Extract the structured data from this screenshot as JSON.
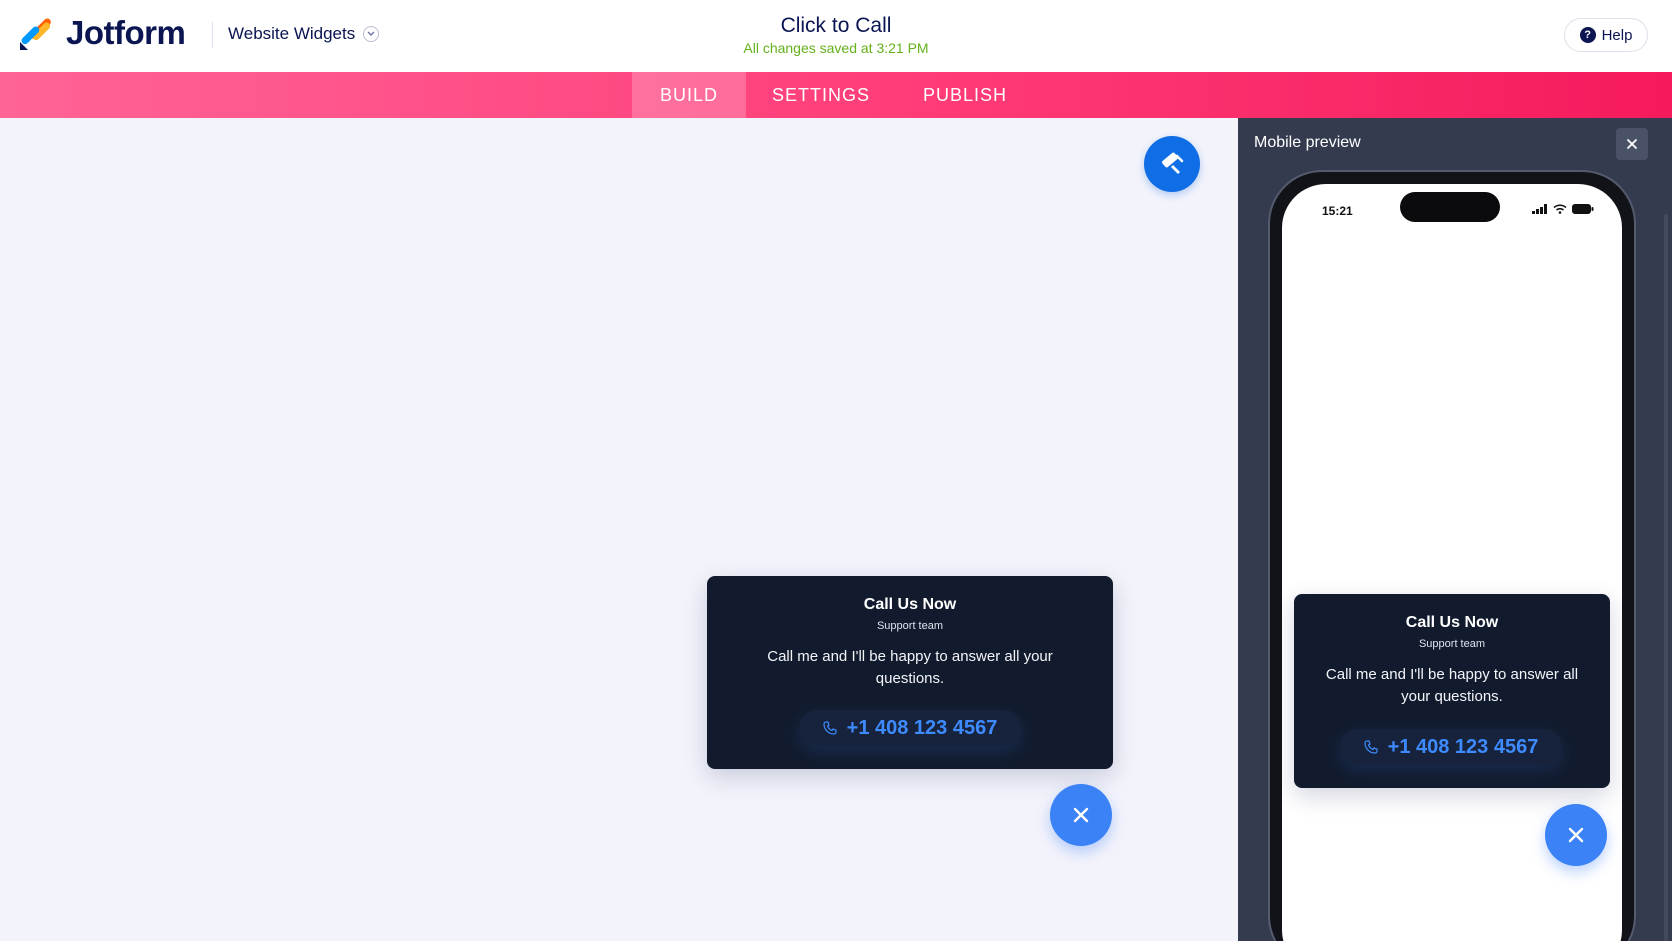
{
  "header": {
    "brand": "Jotform",
    "product_menu": "Website Widgets",
    "form_title": "Click to Call",
    "save_status": "All changes saved at 3:21 PM",
    "help_label": "Help"
  },
  "nav": {
    "tabs": [
      {
        "label": "BUILD",
        "active": true
      },
      {
        "label": "SETTINGS",
        "active": false
      },
      {
        "label": "PUBLISH",
        "active": false
      }
    ]
  },
  "widget": {
    "title": "Call Us Now",
    "subtitle": "Support team",
    "message": "Call me and I'll be happy to answer all your questions.",
    "phone": "+1 408 123 4567"
  },
  "preview": {
    "title": "Mobile preview",
    "status_time": "15:21"
  },
  "colors": {
    "brand_navy": "#0a1551",
    "nav_pink": "#ff3c78",
    "accent_blue": "#3b82f6",
    "card_bg": "#121b2e",
    "saved_green": "#64b21c"
  },
  "icons": {
    "logo": "jotform-logo-icon",
    "designer": "paint-roller-icon",
    "phone": "phone-icon",
    "close": "close-icon",
    "help": "help-circle-icon"
  }
}
